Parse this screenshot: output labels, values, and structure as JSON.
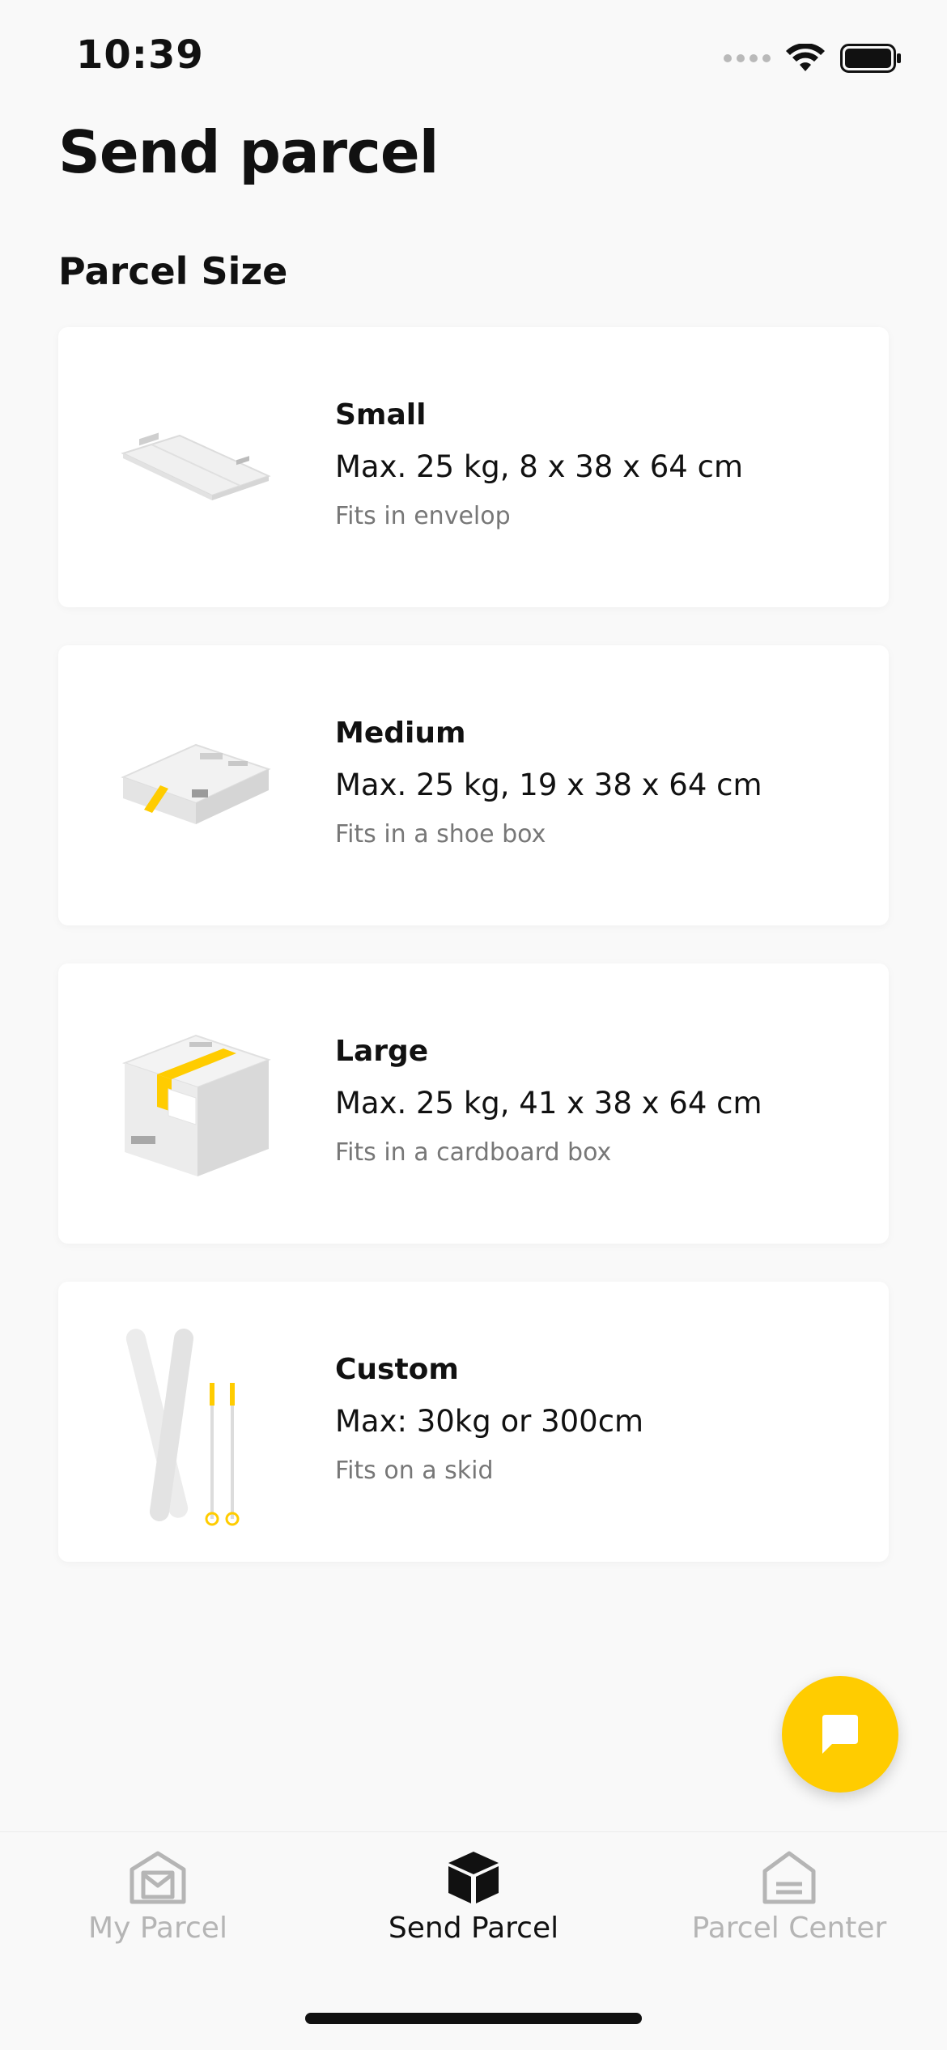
{
  "status_bar": {
    "time": "10:39"
  },
  "header": {
    "title": "Send parcel",
    "section": "Parcel Size"
  },
  "parcel_sizes": [
    {
      "name": "Small",
      "specs": "Max. 25 kg, 8 x 38 x 64 cm",
      "note": "Fits in envelop",
      "icon": "envelope-parcel-icon"
    },
    {
      "name": "Medium",
      "specs": "Max. 25 kg, 19 x 38 x 64 cm",
      "note": "Fits in a shoe box",
      "icon": "shoe-box-parcel-icon"
    },
    {
      "name": "Large",
      "specs": "Max. 25 kg, 41 x 38 x 64 cm",
      "note": "Fits in a cardboard box",
      "icon": "cardboard-box-icon"
    },
    {
      "name": "Custom",
      "specs": "Max: 30kg or 300cm",
      "note": "Fits on a skid",
      "icon": "skis-icon"
    }
  ],
  "fab": {
    "icon": "chat-icon"
  },
  "tab_bar": {
    "tabs": [
      {
        "label": "My Parcel",
        "icon": "mail-tray-icon",
        "active": false
      },
      {
        "label": "Send Parcel",
        "icon": "box-icon",
        "active": true
      },
      {
        "label": "Parcel Center",
        "icon": "parcel-center-icon",
        "active": false
      }
    ]
  },
  "colors": {
    "accent": "#ffcc00",
    "background": "#f9f9f9",
    "card": "#ffffff",
    "inactive": "#b5b5b5",
    "text": "#111111",
    "muted": "#777777"
  }
}
